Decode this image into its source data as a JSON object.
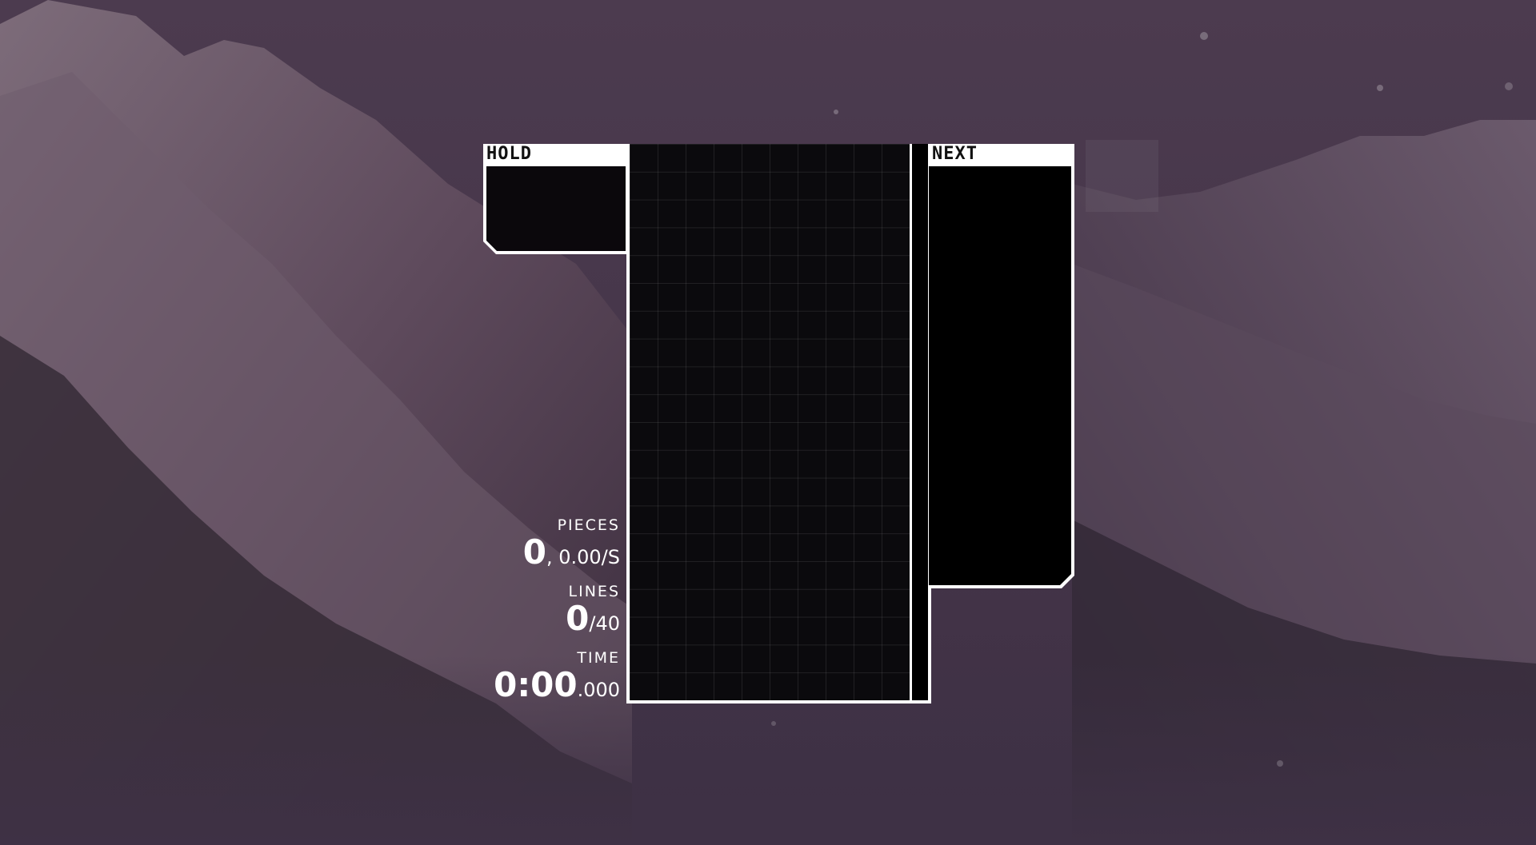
{
  "hold": {
    "title": "HOLD"
  },
  "next": {
    "title": "NEXT"
  },
  "board": {
    "columns": 10,
    "rows": 20
  },
  "stats": {
    "pieces": {
      "label": "PIECES",
      "value": "0",
      "rate": ", 0.00/S"
    },
    "lines": {
      "label": "LINES",
      "value": "0",
      "goal": "/40"
    },
    "time": {
      "label": "TIME",
      "value": "0:00",
      "ms": ".000"
    }
  },
  "colors": {
    "panel_header": "#ffffff",
    "board_bg": "#0b0a0d",
    "text": "#ffffff"
  }
}
